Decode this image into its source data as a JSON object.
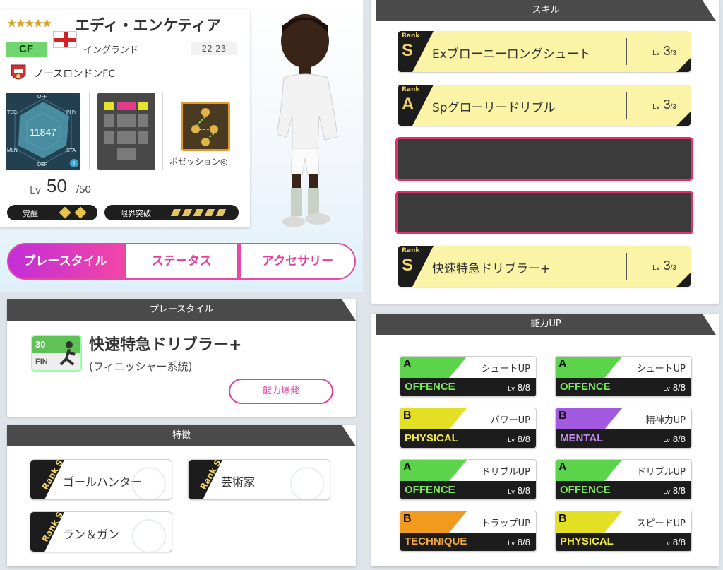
{
  "player": {
    "stars": "★★★★★",
    "name": "エディ・エンケティア",
    "position": "CF",
    "country": "イングランド",
    "season": "22-23",
    "club": "ノースロンドンFC",
    "radar_value": "11847",
    "radar_labels": [
      "OFF",
      "PHY",
      "STA",
      "DEF",
      "MLN",
      "TEC"
    ],
    "position_caption": "ポゼッション◎",
    "level_label": "Lv",
    "level": "50",
    "level_max": "/50",
    "awakening_label": "覚醒",
    "limit_break_label": "限界突破",
    "info_icon_text": "i"
  },
  "tabs": [
    "プレースタイル",
    "ステータス",
    "アクセサリー"
  ],
  "playstyle": {
    "header": "プレースタイル",
    "icon_number": "30",
    "icon_label": "FIN",
    "title": "快速特急ドリブラー+",
    "subtitle": "(フィニッシャー系統)",
    "button": "能力爆発"
  },
  "traits": {
    "header": "特徴",
    "items": [
      {
        "rank": "Rank S",
        "label": "ゴールハンター"
      },
      {
        "rank": "Rank S",
        "label": "芸術家"
      },
      {
        "rank": "Rank S",
        "label": "ラン＆ガン"
      }
    ]
  },
  "skills": {
    "header": "スキル",
    "rank_word": "Rank",
    "items": [
      {
        "rank": "S",
        "name": "Exブローニーロングシュート",
        "lv_label": "Lv",
        "lv": "3",
        "max": "/3"
      },
      {
        "rank": "A",
        "name": "Spグローリードリブル",
        "lv_label": "Lv",
        "lv": "3",
        "max": "/3"
      },
      {
        "rank": "S",
        "name": "快速特急ドリブラー+",
        "lv_label": "Lv",
        "lv": "3",
        "max": "/3"
      }
    ]
  },
  "ability": {
    "header": "能力UP",
    "items": [
      {
        "grade": "A",
        "category": "OFFENCE",
        "name": "シュートUP",
        "lv_label": "Lv",
        "lv": "8/8",
        "color": "#5bd34a",
        "cat_color": "#7be85a"
      },
      {
        "grade": "A",
        "category": "OFFENCE",
        "name": "シュートUP",
        "lv_label": "Lv",
        "lv": "8/8",
        "color": "#5bd34a",
        "cat_color": "#7be85a"
      },
      {
        "grade": "B",
        "category": "PHYSICAL",
        "name": "パワーUP",
        "lv_label": "Lv",
        "lv": "8/8",
        "color": "#e3e025",
        "cat_color": "#f2ea3a"
      },
      {
        "grade": "B",
        "category": "MENTAL",
        "name": "精神力UP",
        "lv_label": "Lv",
        "lv": "8/8",
        "color": "#a25be0",
        "cat_color": "#c58af5"
      },
      {
        "grade": "A",
        "category": "OFFENCE",
        "name": "ドリブルUP",
        "lv_label": "Lv",
        "lv": "8/8",
        "color": "#5bd34a",
        "cat_color": "#7be85a"
      },
      {
        "grade": "A",
        "category": "OFFENCE",
        "name": "ドリブルUP",
        "lv_label": "Lv",
        "lv": "8/8",
        "color": "#5bd34a",
        "cat_color": "#7be85a"
      },
      {
        "grade": "B",
        "category": "TECHNIQUE",
        "name": "トラップUP",
        "lv_label": "Lv",
        "lv": "8/8",
        "color": "#f09a1e",
        "cat_color": "#f5a93a"
      },
      {
        "grade": "B",
        "category": "PHYSICAL",
        "name": "スピードUP",
        "lv_label": "Lv",
        "lv": "8/8",
        "color": "#e3e025",
        "cat_color": "#f2ea3a"
      }
    ]
  },
  "colors": {
    "accent_pink": "#e23e9e",
    "skill_yellow": "#fbf4a6",
    "panel_header": "#4a4a4a"
  }
}
